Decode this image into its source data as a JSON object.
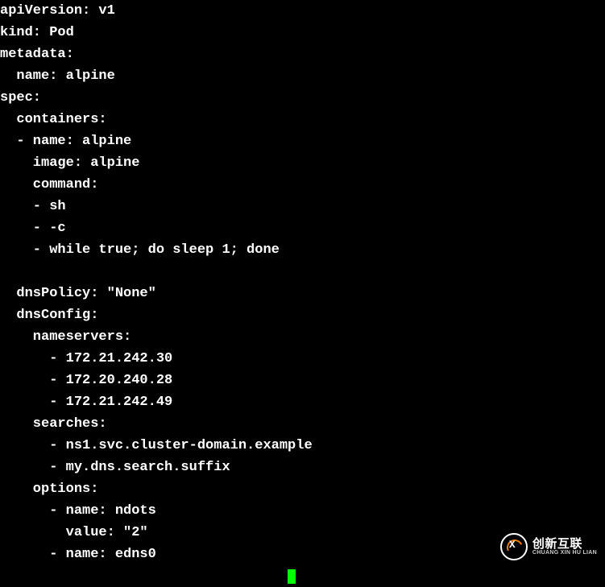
{
  "lines": [
    "apiVersion: v1",
    "kind: Pod",
    "metadata:",
    "  name: alpine",
    "spec:",
    "  containers:",
    "  - name: alpine",
    "    image: alpine",
    "    command:",
    "    - sh",
    "    - -c",
    "    - while true; do sleep 1; done",
    "",
    "  dnsPolicy: \"None\"",
    "  dnsConfig:",
    "    nameservers:",
    "      - 172.21.242.30",
    "      - 172.20.240.28",
    "      - 172.21.242.49",
    "    searches:",
    "      - ns1.svc.cluster-domain.example",
    "      - my.dns.search.suffix",
    "    options:",
    "      - name: ndots",
    "        value: \"2\"",
    "      - name: edns0"
  ],
  "watermark": {
    "brand": "创新互联",
    "sub": "CHUANG XIN HU LIAN"
  }
}
